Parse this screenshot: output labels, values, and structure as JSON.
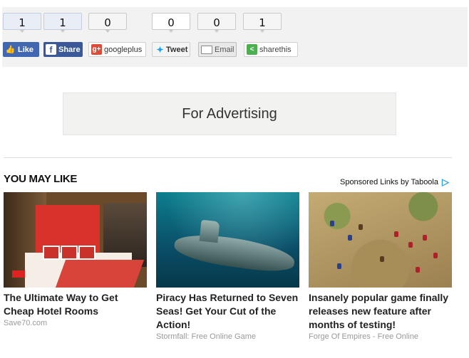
{
  "share": {
    "counts": [
      {
        "value": "1",
        "style": "blue"
      },
      {
        "value": "1",
        "style": "blue"
      },
      {
        "value": "0",
        "style": "gray"
      },
      {
        "value": "0",
        "style": "white"
      },
      {
        "value": "0",
        "style": "gray"
      },
      {
        "value": "1",
        "style": "gray"
      }
    ],
    "buttons": {
      "like": "Like",
      "share": "Share",
      "googleplus": "googleplus",
      "tweet": "Tweet",
      "email": "Email",
      "sharethis": "sharethis"
    },
    "icons": {
      "like": "thumbs-up-icon",
      "share": "facebook-icon",
      "googleplus": "google-plus-icon",
      "tweet": "twitter-bird-icon",
      "email": "envelope-icon",
      "sharethis": "share-icon"
    }
  },
  "ad": {
    "text": "For Advertising"
  },
  "recommendations": {
    "heading": "YOU MAY LIKE",
    "sponsored_label": "Sponsored Links by Taboola",
    "cards": [
      {
        "title": "The Ultimate Way to Get Cheap Hotel Rooms",
        "source": "Save70.com",
        "image": "hotel-room-image"
      },
      {
        "title": "Piracy Has Returned to Seven Seas! Get Your Cut of the Action!",
        "source": "Stormfall: Free Online Game",
        "image": "submarine-image"
      },
      {
        "title": "Insanely popular game finally releases new feature after months of testing!",
        "source": "Forge Of Empires - Free Online",
        "image": "battle-game-image"
      }
    ]
  },
  "colors": {
    "facebook": "#3b5998",
    "facebook_like": "#4267b2",
    "googleplus": "#dd4b39",
    "twitter": "#1da1f2",
    "sharethis": "#4caf50",
    "taboola": "#2aa1e2"
  }
}
